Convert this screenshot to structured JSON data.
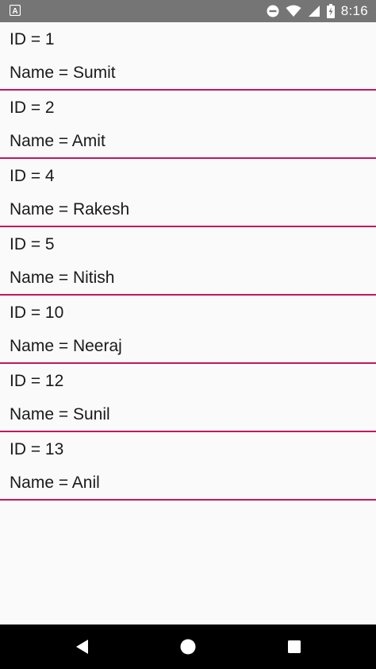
{
  "status_bar": {
    "time": "8:16",
    "notification_icon": "app-a-icon",
    "icons": [
      "dnd-icon",
      "wifi-icon",
      "signal-icon",
      "battery-charging-icon"
    ],
    "background_color": "#757575"
  },
  "list": {
    "divider_color": "#c2185b",
    "items": [
      {
        "id_text": "ID = 1",
        "name_text": "Name = Sumit"
      },
      {
        "id_text": "ID = 2",
        "name_text": "Name = Amit"
      },
      {
        "id_text": "ID = 4",
        "name_text": "Name = Rakesh"
      },
      {
        "id_text": "ID = 5",
        "name_text": "Name = Nitish"
      },
      {
        "id_text": "ID = 10",
        "name_text": "Name = Neeraj"
      },
      {
        "id_text": "ID = 12",
        "name_text": "Name = Sunil"
      },
      {
        "id_text": "ID = 13",
        "name_text": "Name = Anil"
      }
    ]
  },
  "nav_bar": {
    "buttons": [
      "back-icon",
      "home-icon",
      "recents-icon"
    ],
    "background_color": "#000000"
  }
}
